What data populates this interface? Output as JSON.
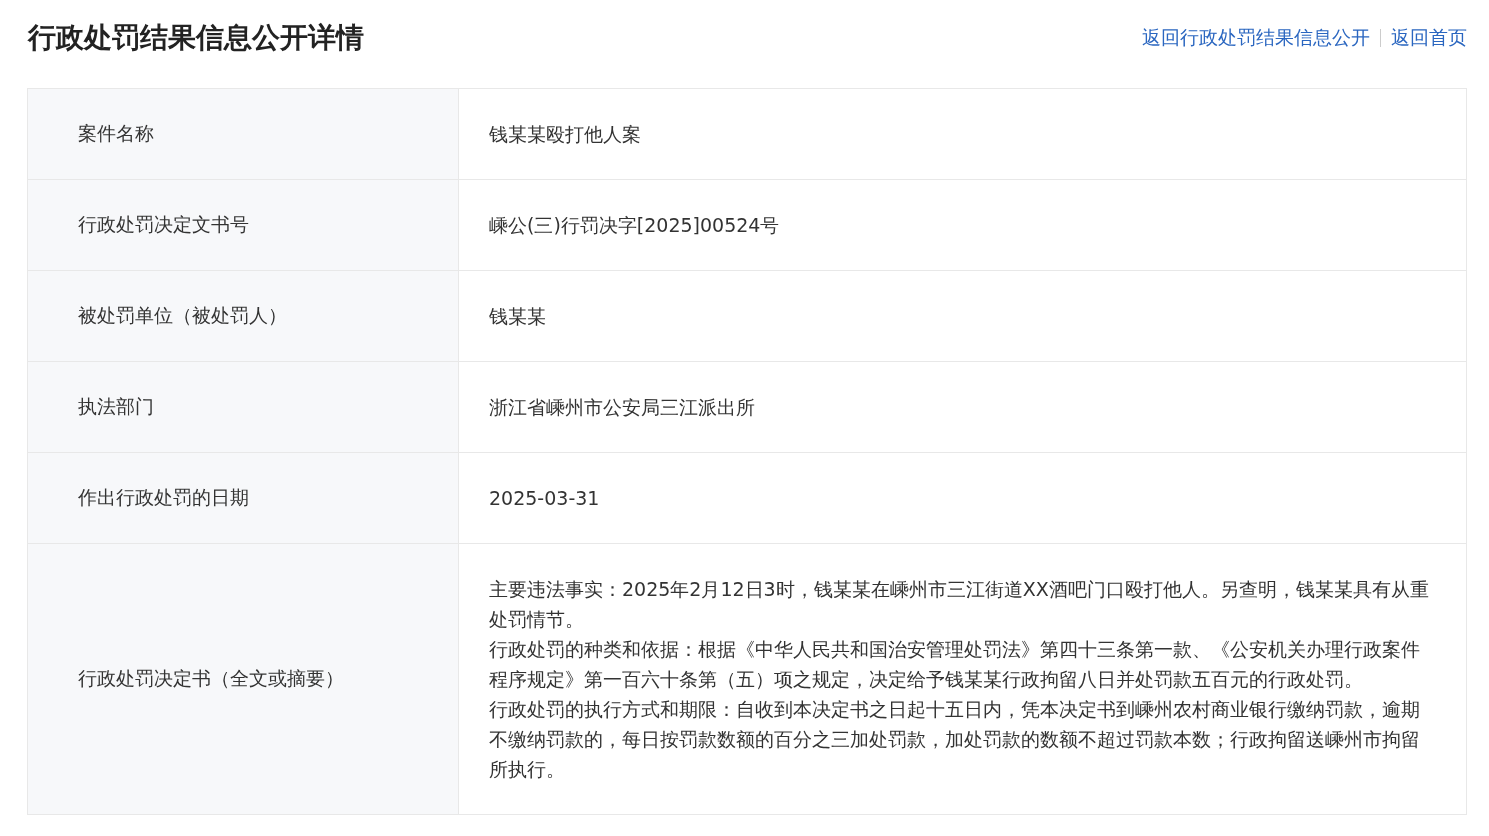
{
  "page_title": "行政处罚结果信息公开详情",
  "nav_links": [
    "返回行政处罚结果信息公开",
    "返回首页"
  ],
  "details": [
    {
      "label": "案件名称",
      "value": [
        "钱某某殴打他人案"
      ]
    },
    {
      "label": "行政处罚决定文书号",
      "value": [
        "嵊公(三)行罚决字[2025]00524号"
      ]
    },
    {
      "label": "被处罚单位（被处罚人）",
      "value": [
        "钱某某"
      ]
    },
    {
      "label": "执法部门",
      "value": [
        "浙江省嵊州市公安局三江派出所"
      ]
    },
    {
      "label": "作出行政处罚的日期",
      "value": [
        "2025-03-31"
      ]
    },
    {
      "label": "行政处罚决定书（全文或摘要）",
      "value": [
        "主要违法事实：2025年2月12日3时，钱某某在嵊州市三江街道XX酒吧门口殴打他人。另查明，钱某某具有从重处罚情节。",
        "行政处罚的种类和依据：根据《中华人民共和国治安管理处罚法》第四十三条第一款、《公安机关办理行政案件程序规定》第一百六十条第（五）项之规定，决定给予钱某某行政拘留八日并处罚款五百元的行政处罚。",
        "行政处罚的执行方式和期限：自收到本决定书之日起十五日内，凭本决定书到嵊州农村商业银行缴纳罚款，逾期不缴纳罚款的，每日按罚款数额的百分之三加处罚款，加处罚款的数额不超过罚款本数；行政拘留送嵊州市拘留所执行。"
      ]
    }
  ]
}
